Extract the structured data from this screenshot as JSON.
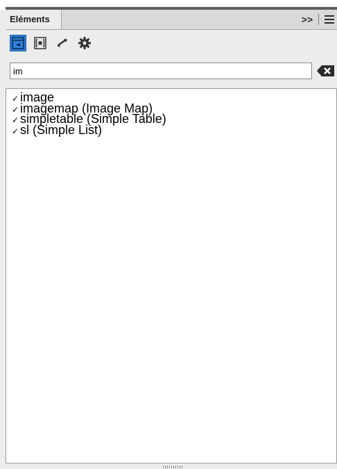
{
  "panel": {
    "tab_label": "Eléments",
    "overflow_label": ">>"
  },
  "toolbar": {
    "buttons": [
      {
        "name": "insert-element-icon",
        "active": true
      },
      {
        "name": "wrap-element-icon",
        "active": false
      },
      {
        "name": "swap-element-icon",
        "active": false
      },
      {
        "name": "settings-gear-icon",
        "active": false
      }
    ]
  },
  "search": {
    "value": "im"
  },
  "elements": [
    {
      "check": "✓",
      "label": "image"
    },
    {
      "check": "✓",
      "label": "imagemap  (Image Map)"
    },
    {
      "check": "✓",
      "label": "simpletable  (Simple Table)"
    },
    {
      "check": "✓",
      "label": "sl  (Simple List)"
    }
  ],
  "colors": {
    "accent": "#2f7fd8",
    "panel_bg": "#ececec"
  }
}
